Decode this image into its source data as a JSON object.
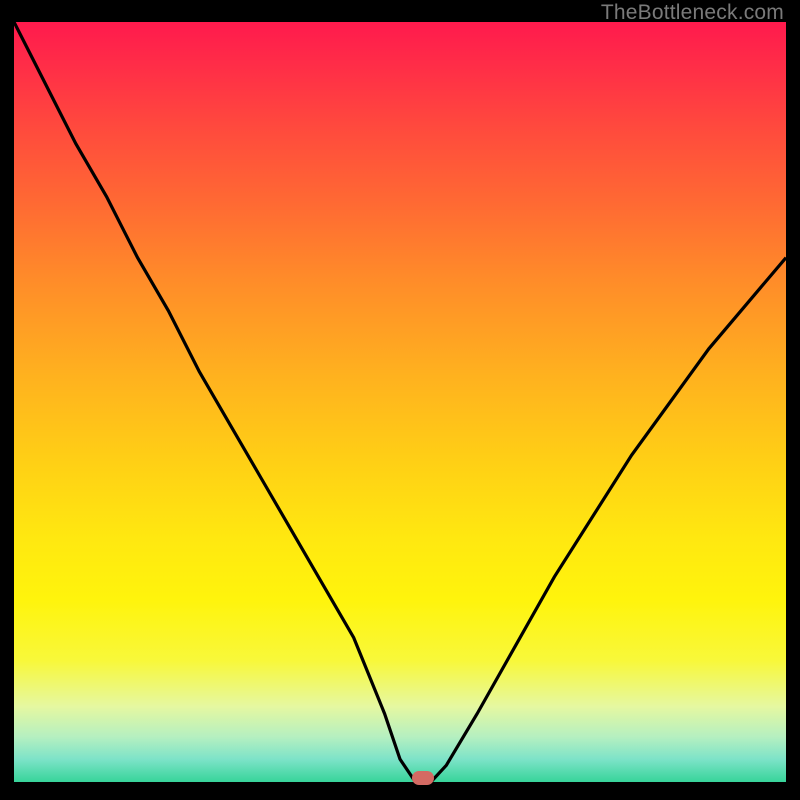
{
  "watermark": "TheBottleneck.com",
  "colors": {
    "frame_bg": "#000000",
    "curve": "#000000",
    "marker": "#d46a63",
    "watermark": "#7a7a7a",
    "gradient_top": "#ff1a4d",
    "gradient_bottom": "#37d49a"
  },
  "chart_data": {
    "type": "line",
    "title": "",
    "xlabel": "",
    "ylabel": "",
    "xlim": [
      0,
      100
    ],
    "ylim": [
      0,
      100
    ],
    "grid": false,
    "series": [
      {
        "name": "bottleneck-curve",
        "x": [
          0,
          2,
          5,
          8,
          12,
          16,
          20,
          24,
          28,
          32,
          36,
          40,
          44,
          48,
          50,
          52,
          54,
          56,
          60,
          65,
          70,
          75,
          80,
          85,
          90,
          95,
          100
        ],
        "values": [
          100,
          96,
          90,
          84,
          77,
          69,
          62,
          54,
          47,
          40,
          33,
          26,
          19,
          9,
          3,
          0,
          0,
          2.2,
          9,
          18,
          27,
          35,
          43,
          50,
          57,
          63,
          69
        ]
      }
    ],
    "annotations": [
      {
        "name": "optimal-marker",
        "x": 53,
        "y": 0.5
      }
    ],
    "legend": false
  }
}
